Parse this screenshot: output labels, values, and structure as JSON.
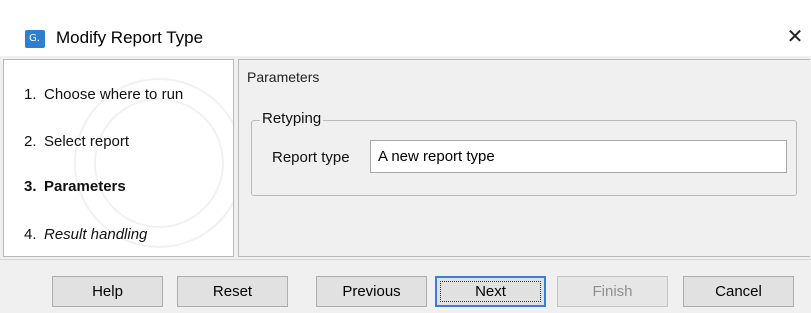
{
  "window": {
    "title": "Modify Report Type",
    "app_icon_label": "G.",
    "icon": "clc-workbench-icon",
    "close_glyph": "✕"
  },
  "steps": [
    {
      "number": "1.",
      "label": "Choose where to run",
      "style": "normal"
    },
    {
      "number": "2.",
      "label": "Select report",
      "style": "normal"
    },
    {
      "number": "3.",
      "label": "Parameters",
      "style": "bold"
    },
    {
      "number": "4.",
      "label": "Result handling",
      "style": "italic"
    }
  ],
  "content": {
    "title": "Parameters",
    "group": {
      "title": "Retyping",
      "field_label": "Report type",
      "field_value": "A new report type"
    }
  },
  "buttons": {
    "help": "Help",
    "reset": "Reset",
    "previous": "Previous",
    "next": "Next",
    "finish": "Finish",
    "cancel": "Cancel"
  },
  "colors": {
    "accent": "#3c7fd0",
    "app_icon": "#2e7fd1"
  }
}
